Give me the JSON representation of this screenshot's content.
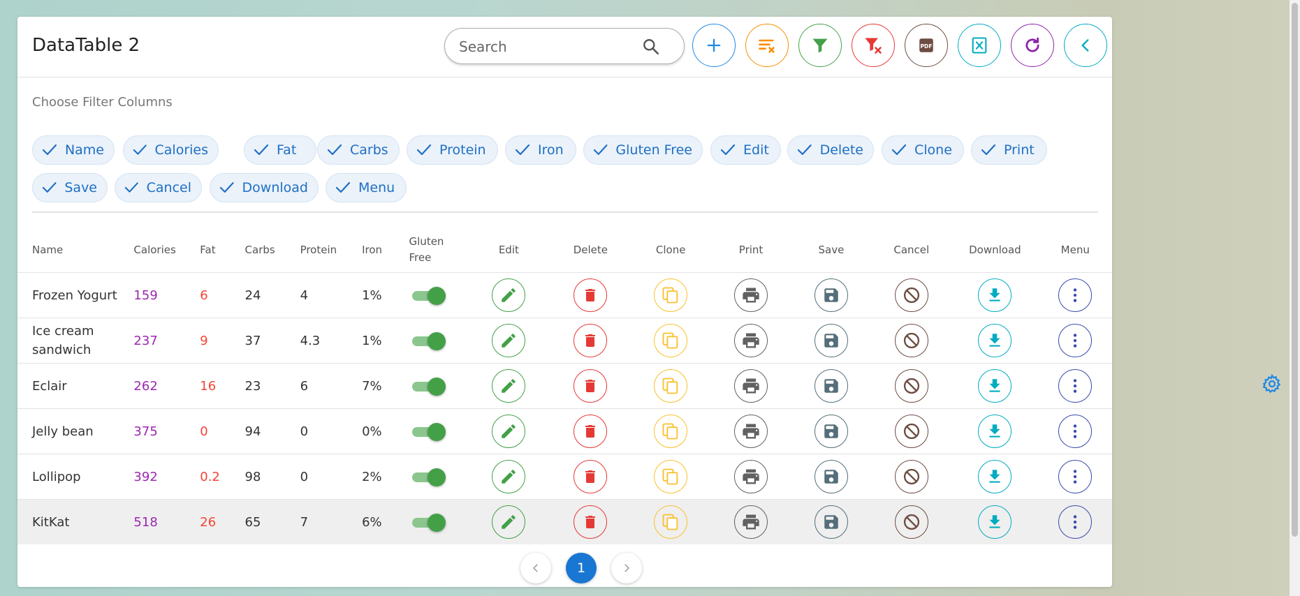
{
  "header": {
    "title": "DataTable 2",
    "search_placeholder": "Search"
  },
  "toolbar": [
    {
      "name": "add-button",
      "icon": "plus-icon",
      "color": "#1e88e5"
    },
    {
      "name": "clear-sort-button",
      "icon": "sort-clear-icon",
      "color": "#fb8c00"
    },
    {
      "name": "filter-button",
      "icon": "filter-icon",
      "color": "#43a047"
    },
    {
      "name": "clear-filter-button",
      "icon": "filter-remove-icon",
      "color": "#e53935"
    },
    {
      "name": "export-pdf-button",
      "icon": "pdf-icon",
      "color": "#6d4c41"
    },
    {
      "name": "export-excel-button",
      "icon": "excel-icon",
      "color": "#00acc1"
    },
    {
      "name": "refresh-button",
      "icon": "refresh-icon",
      "color": "#8e24aa"
    },
    {
      "name": "collapse-button",
      "icon": "chevron-left-icon",
      "color": "#00acc1"
    }
  ],
  "filter": {
    "label": "Choose Filter Columns",
    "chips": [
      "Name",
      "Calories",
      "Fat",
      "Carbs",
      "Protein",
      "Iron",
      "Gluten Free",
      "Edit",
      "Delete",
      "Clone",
      "Print",
      "Save",
      "Cancel",
      "Download",
      "Menu"
    ]
  },
  "table": {
    "headers": {
      "name": "Name",
      "calories": "Calories",
      "fat": "Fat",
      "carbs": "Carbs",
      "protein": "Protein",
      "iron": "Iron",
      "gluten_free": "Gluten Free",
      "edit": "Edit",
      "delete": "Delete",
      "clone": "Clone",
      "print": "Print",
      "save": "Save",
      "cancel": "Cancel",
      "download": "Download",
      "menu": "Menu"
    },
    "rows": [
      {
        "name": "Frozen Yogurt",
        "calories": "159",
        "fat": "6",
        "carbs": "24",
        "protein": "4",
        "iron": "1%",
        "gluten_free": true
      },
      {
        "name": "Ice cream sandwich",
        "calories": "237",
        "fat": "9",
        "carbs": "37",
        "protein": "4.3",
        "iron": "1%",
        "gluten_free": true
      },
      {
        "name": "Eclair",
        "calories": "262",
        "fat": "16",
        "carbs": "23",
        "protein": "6",
        "iron": "7%",
        "gluten_free": true
      },
      {
        "name": "Jelly bean",
        "calories": "375",
        "fat": "0",
        "carbs": "94",
        "protein": "0",
        "iron": "0%",
        "gluten_free": true
      },
      {
        "name": "Lollipop",
        "calories": "392",
        "fat": "0.2",
        "carbs": "98",
        "protein": "0",
        "iron": "2%",
        "gluten_free": true
      },
      {
        "name": "KitKat",
        "calories": "518",
        "fat": "26",
        "carbs": "65",
        "protein": "7",
        "iron": "6%",
        "gluten_free": true
      }
    ],
    "actions": [
      {
        "key": "edit",
        "icon": "pencil-icon",
        "color": "#43a047"
      },
      {
        "key": "delete",
        "icon": "trash-icon",
        "color": "#e53935"
      },
      {
        "key": "clone",
        "icon": "copy-icon",
        "color": "#fbc02d"
      },
      {
        "key": "print",
        "icon": "printer-icon",
        "color": "#616161"
      },
      {
        "key": "save",
        "icon": "floppy-icon",
        "color": "#546e7a"
      },
      {
        "key": "cancel",
        "icon": "cancel-icon",
        "color": "#6d4c41"
      },
      {
        "key": "download",
        "icon": "download-icon",
        "color": "#00acc1"
      },
      {
        "key": "menu",
        "icon": "dots-vertical-icon",
        "color": "#3949ab"
      }
    ]
  },
  "pagination": {
    "current_page": "1"
  },
  "colors": {
    "calories": "#9c27b0",
    "fat": "#f44336",
    "toggle_on": "#43a047",
    "primary": "#1976d2",
    "chip_text": "#1e6fc4"
  }
}
